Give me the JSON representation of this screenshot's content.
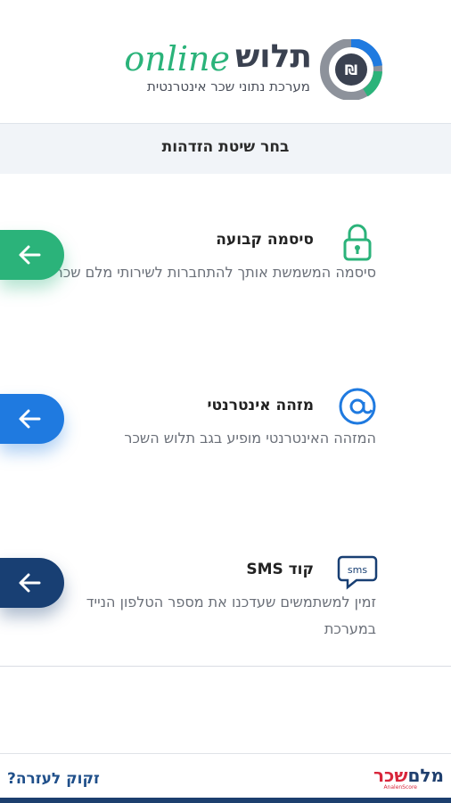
{
  "header": {
    "brand_hebrew": "תלוש",
    "brand_online": "online",
    "subtitle": "מערכת נתוני שכר אינטרנטית"
  },
  "method_bar": {
    "title": "בחר שיטת הזדהות"
  },
  "options": [
    {
      "title": "סיסמה קבועה",
      "description": "סיסמה המשמשת אותך להתחברות לשירותי מלם שכר",
      "icon": "padlock-icon",
      "button_color": "#2bb37a"
    },
    {
      "title": "מזהה אינטרנטי",
      "description": "המזהה האינטרנטי מופיע בגב תלוש השכר",
      "icon": "at-sign-icon",
      "button_color": "#1f7ae0"
    },
    {
      "title": "קוד SMS",
      "description": "זמין למשתמשים שעדכנו את מספר הטלפון הנייד במערכת",
      "icon": "sms-bubble-icon",
      "icon_text": "sms",
      "button_color": "#183f73"
    }
  ],
  "footer": {
    "help_link": "זקוק לעזרה?",
    "logo_part1": "מלם",
    "logo_part2": "שכר",
    "logo_tagline": "AnalenScore"
  }
}
